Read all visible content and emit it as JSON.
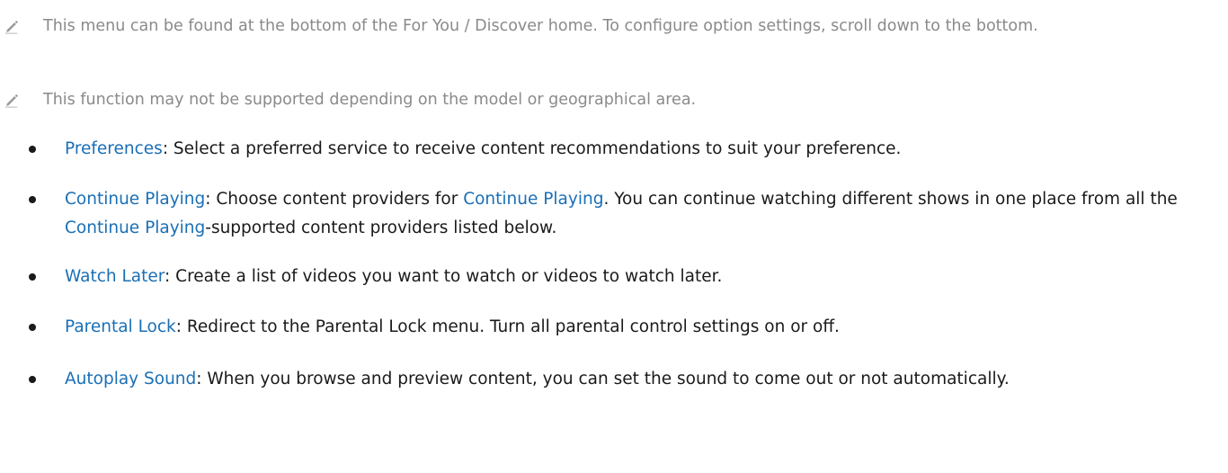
{
  "notes": [
    "This menu can be found at the bottom of the For You / Discover home. To configure option settings, scroll down to the bottom.",
    "This function may not be supported depending on the model or geographical area."
  ],
  "items": [
    {
      "term": "Preferences",
      "text": ": Select a preferred service to receive content recommendations to suit your preference."
    },
    {
      "term": "Continue Playing",
      "text_a": ": Choose content providers for ",
      "ref_1": "Continue Playing",
      "text_b": ". You can continue watching different shows in one place from all the ",
      "ref_2": "Continue Playing",
      "text_c": "-supported content providers listed below."
    },
    {
      "term": "Watch Later",
      "text": ": Create a list of videos you want to watch or videos to watch later."
    },
    {
      "term": "Parental Lock",
      "text": ": Redirect to the Parental Lock menu. Turn all parental control settings on or off."
    },
    {
      "term": "Autoplay Sound",
      "text": ": When you browse and preview content, you can set the sound to come out or not automatically."
    }
  ],
  "colors": {
    "link": "#1a6fb5",
    "note_text": "#8a8a8a",
    "body_text": "#1a1a1a"
  },
  "icons": {
    "note": "pencil-icon"
  }
}
